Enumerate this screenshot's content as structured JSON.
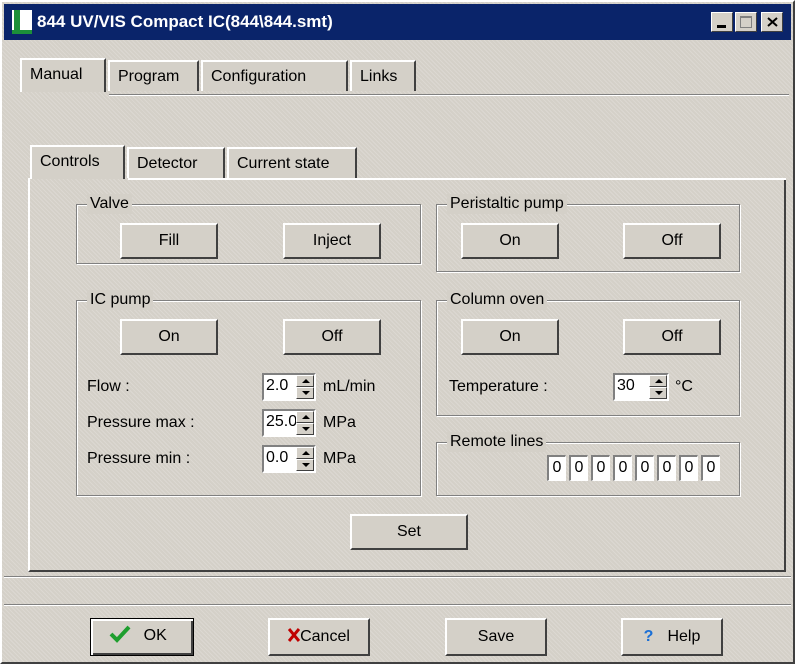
{
  "window": {
    "title": "844 UV/VIS Compact IC(844\\844.smt)"
  },
  "outer_tabs": [
    {
      "label": "Manual"
    },
    {
      "label": "Program"
    },
    {
      "label": "Configuration"
    },
    {
      "label": "Links"
    }
  ],
  "inner_tabs": [
    {
      "label": "Controls"
    },
    {
      "label": "Detector"
    },
    {
      "label": "Current state"
    }
  ],
  "valve": {
    "title": "Valve",
    "fill_label": "Fill",
    "inject_label": "Inject"
  },
  "peristaltic_pump": {
    "title": "Peristaltic pump",
    "on_label": "On",
    "off_label": "Off"
  },
  "ic_pump": {
    "title": "IC pump",
    "on_label": "On",
    "off_label": "Off",
    "flow": {
      "label": "Flow :",
      "value": "2.0",
      "unit": "mL/min"
    },
    "pressure_max": {
      "label": "Pressure max :",
      "value": "25.0",
      "unit": "MPa"
    },
    "pressure_min": {
      "label": "Pressure min :",
      "value": "0.0",
      "unit": "MPa"
    }
  },
  "column_oven": {
    "title": "Column oven",
    "on_label": "On",
    "off_label": "Off",
    "temperature": {
      "label": "Temperature :",
      "value": "30",
      "unit": "°C"
    }
  },
  "remote_lines": {
    "title": "Remote lines",
    "bits": [
      "0",
      "0",
      "0",
      "0",
      "0",
      "0",
      "0",
      "0"
    ]
  },
  "set_label": "Set",
  "footer": {
    "ok_label": "OK",
    "cancel_label": "Cancel",
    "save_label": "Save",
    "help_label": "Help"
  },
  "colors": {
    "titlebar": "#0a246a",
    "face": "#d4d0c8"
  }
}
